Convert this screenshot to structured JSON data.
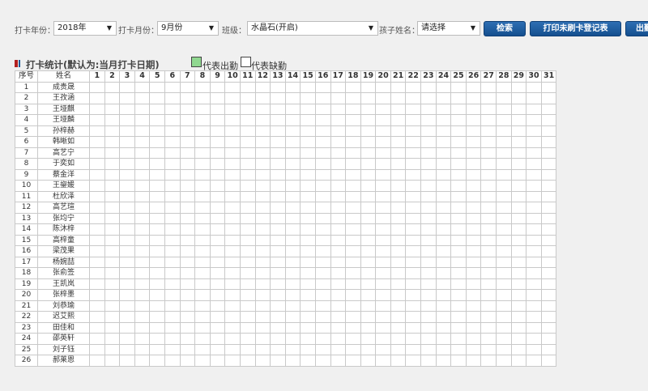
{
  "toolbar": {
    "year_label": "打卡年份：",
    "year_value": "2018年",
    "month_label": "打卡月份：",
    "month_value": "9月份",
    "class_label": "班级：",
    "class_value": "水晶石(开启)",
    "child_label": "孩子姓名：",
    "child_value": "请选择",
    "search_label": "检索",
    "print_label": "打印未刷卡登记表",
    "export_label": "出勤"
  },
  "section": {
    "title": "打卡统计(默认为:当月打卡日期)",
    "legend_present": "代表出勤",
    "legend_absent": "代表缺勤"
  },
  "colors": {
    "present": "#90d890",
    "absent": "#ffffff",
    "button": "#1f5fa3"
  },
  "table": {
    "col_index": "序号",
    "col_name": "姓名",
    "days": [
      "1",
      "2",
      "3",
      "4",
      "5",
      "6",
      "7",
      "8",
      "9",
      "10",
      "11",
      "12",
      "13",
      "14",
      "15",
      "16",
      "17",
      "18",
      "19",
      "20",
      "21",
      "22",
      "23",
      "24",
      "25",
      "26",
      "27",
      "28",
      "29",
      "30",
      "31"
    ],
    "rows": [
      {
        "no": "1",
        "name": "成贵晟"
      },
      {
        "no": "2",
        "name": "王孜涵"
      },
      {
        "no": "3",
        "name": "王垭麒"
      },
      {
        "no": "4",
        "name": "王垭麟"
      },
      {
        "no": "5",
        "name": "孙梓赫"
      },
      {
        "no": "6",
        "name": "韩晰如"
      },
      {
        "no": "7",
        "name": "高艺宁"
      },
      {
        "no": "8",
        "name": "于奕如"
      },
      {
        "no": "9",
        "name": "蔡金洋"
      },
      {
        "no": "10",
        "name": "王鋆媛"
      },
      {
        "no": "11",
        "name": "杜欣泽"
      },
      {
        "no": "12",
        "name": "高艺瑄"
      },
      {
        "no": "13",
        "name": "张均宁"
      },
      {
        "no": "14",
        "name": "陈沐梓"
      },
      {
        "no": "15",
        "name": "高梓童"
      },
      {
        "no": "16",
        "name": "梁茂果"
      },
      {
        "no": "17",
        "name": "杨婉喆"
      },
      {
        "no": "18",
        "name": "张俞签"
      },
      {
        "no": "19",
        "name": "王凯岚"
      },
      {
        "no": "20",
        "name": "张梓墨"
      },
      {
        "no": "21",
        "name": "刘恭瑜"
      },
      {
        "no": "22",
        "name": "迟艾熙"
      },
      {
        "no": "23",
        "name": "田佳和"
      },
      {
        "no": "24",
        "name": "邵英轩"
      },
      {
        "no": "25",
        "name": "刘子钰"
      },
      {
        "no": "26",
        "name": "郝莱恩"
      }
    ]
  }
}
